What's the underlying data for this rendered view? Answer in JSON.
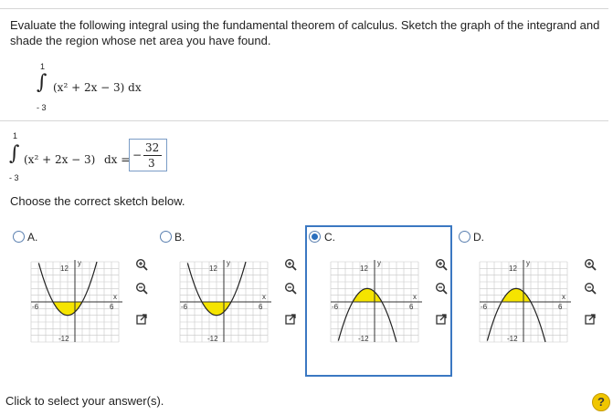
{
  "prompt": "Evaluate the following integral using the fundamental theorem of calculus. Sketch the graph of the integrand and shade the region whose net area you have found.",
  "integral": {
    "upper": "1",
    "lower": "- 3",
    "integrand": "(x² + 2x − 3) dx"
  },
  "answer": {
    "equals": "dx =",
    "sign": "−",
    "numerator": "32",
    "denominator": "3"
  },
  "choose_label": "Choose the correct sketch below.",
  "options": [
    {
      "letter": "A.",
      "selected": false
    },
    {
      "letter": "B.",
      "selected": false
    },
    {
      "letter": "C.",
      "selected": true
    },
    {
      "letter": "D.",
      "selected": false
    }
  ],
  "graph_labels": {
    "y_axis": "y",
    "x_axis": "x",
    "y_top": "12",
    "y_bottom": "-12",
    "x_left": "-6",
    "x_right": "6"
  },
  "footer": "Click to select your answer(s).",
  "help": "?",
  "colors": {
    "accent": "#3b78c2",
    "shade": "#f5e400",
    "curve": "#222222"
  }
}
